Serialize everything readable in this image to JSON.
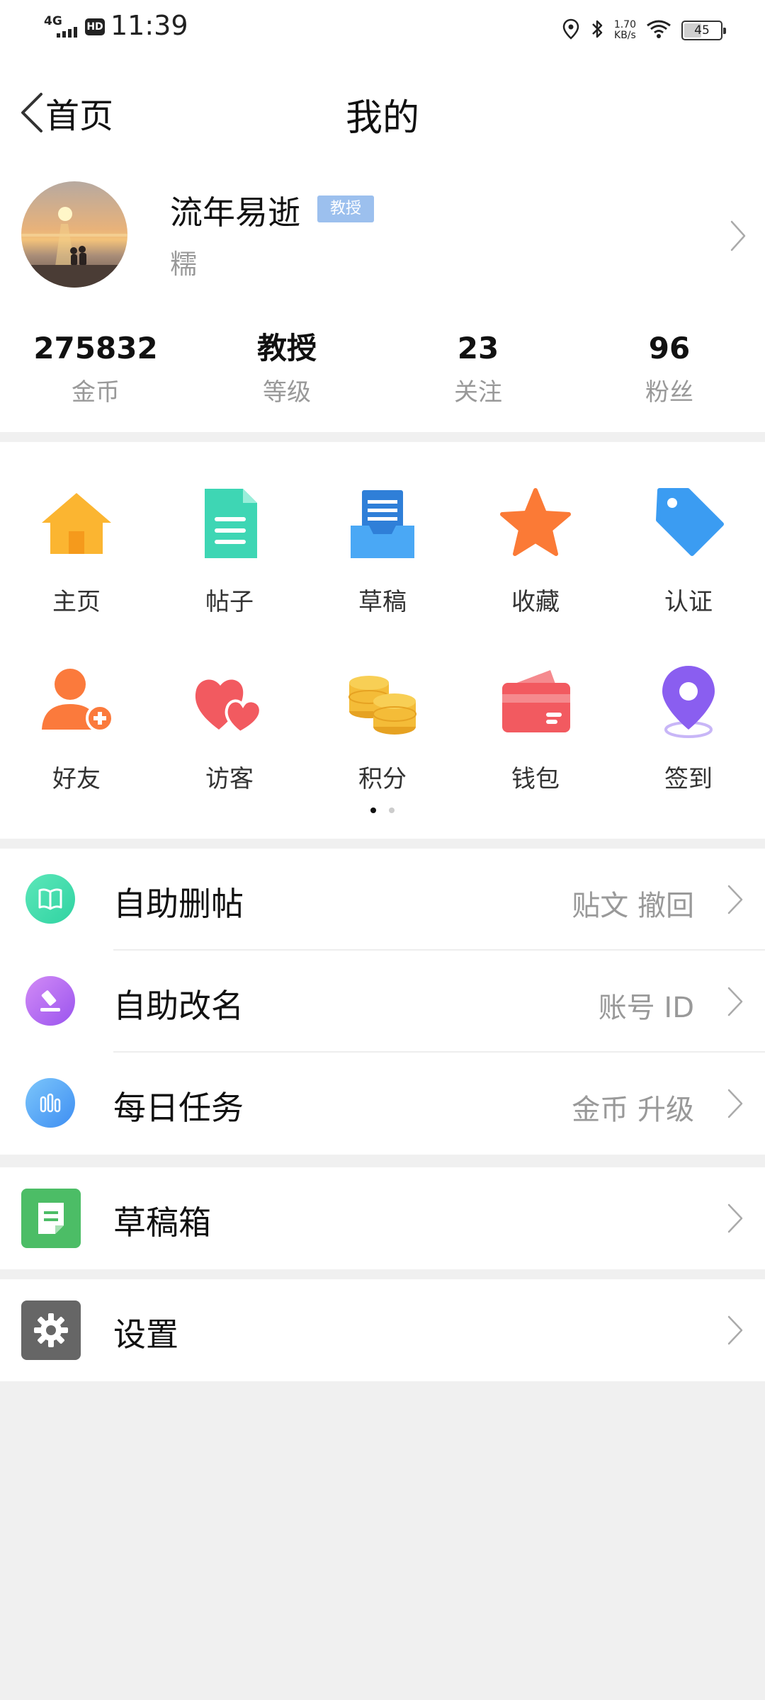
{
  "status_bar": {
    "network": "4G",
    "hd": "HD",
    "time": "11:39",
    "speed_value": "1.70",
    "speed_unit": "KB/s",
    "battery": "45",
    "battery_level": 0.45
  },
  "nav": {
    "back_label": "首页",
    "title": "我的"
  },
  "profile": {
    "username": "流年易逝",
    "rank_badge": "教授",
    "signature": "糯",
    "stats": [
      {
        "value": "275832",
        "label": "金币"
      },
      {
        "value": "教授",
        "label": "等级"
      },
      {
        "value": "23",
        "label": "关注"
      },
      {
        "value": "96",
        "label": "粉丝"
      }
    ]
  },
  "grid": {
    "page": 1,
    "pages": 2,
    "rows": [
      [
        {
          "label": "主页",
          "icon": "home-icon",
          "color": "#fbb531"
        },
        {
          "label": "帖子",
          "icon": "document-icon",
          "color": "#3ed6b4"
        },
        {
          "label": "草稿",
          "icon": "draft-tray-icon",
          "color": "#3d9ef0"
        },
        {
          "label": "收藏",
          "icon": "star-icon",
          "color": "#fb7a36"
        },
        {
          "label": "认证",
          "icon": "tag-icon",
          "color": "#3b9cf2"
        }
      ],
      [
        {
          "label": "好友",
          "icon": "add-friend-icon",
          "color": "#fb7a3c"
        },
        {
          "label": "访客",
          "icon": "hearts-icon",
          "color": "#f25a60"
        },
        {
          "label": "积分",
          "icon": "coins-icon",
          "color": "#f4bc38"
        },
        {
          "label": "钱包",
          "icon": "wallet-icon",
          "color": "#f25a60"
        },
        {
          "label": "签到",
          "icon": "location-pin-icon",
          "color": "#8a5ef0"
        }
      ]
    ]
  },
  "list_group1": [
    {
      "label": "自助删帖",
      "hint": "贴文   撤回",
      "icon": "book-icon",
      "color": "#30d3a2"
    },
    {
      "label": "自助改名",
      "hint": "账号   ID",
      "icon": "gavel-icon",
      "color": "#b25cf0"
    },
    {
      "label": "每日任务",
      "hint": "金币   升级",
      "icon": "bar-chart-icon",
      "color": "#4aa8f5"
    }
  ],
  "list_group2": [
    {
      "label": "草稿箱",
      "icon": "note-icon",
      "color": "#4cbd66"
    }
  ],
  "list_group3": [
    {
      "label": "设置",
      "icon": "gear-icon",
      "color": "#666666"
    }
  ]
}
